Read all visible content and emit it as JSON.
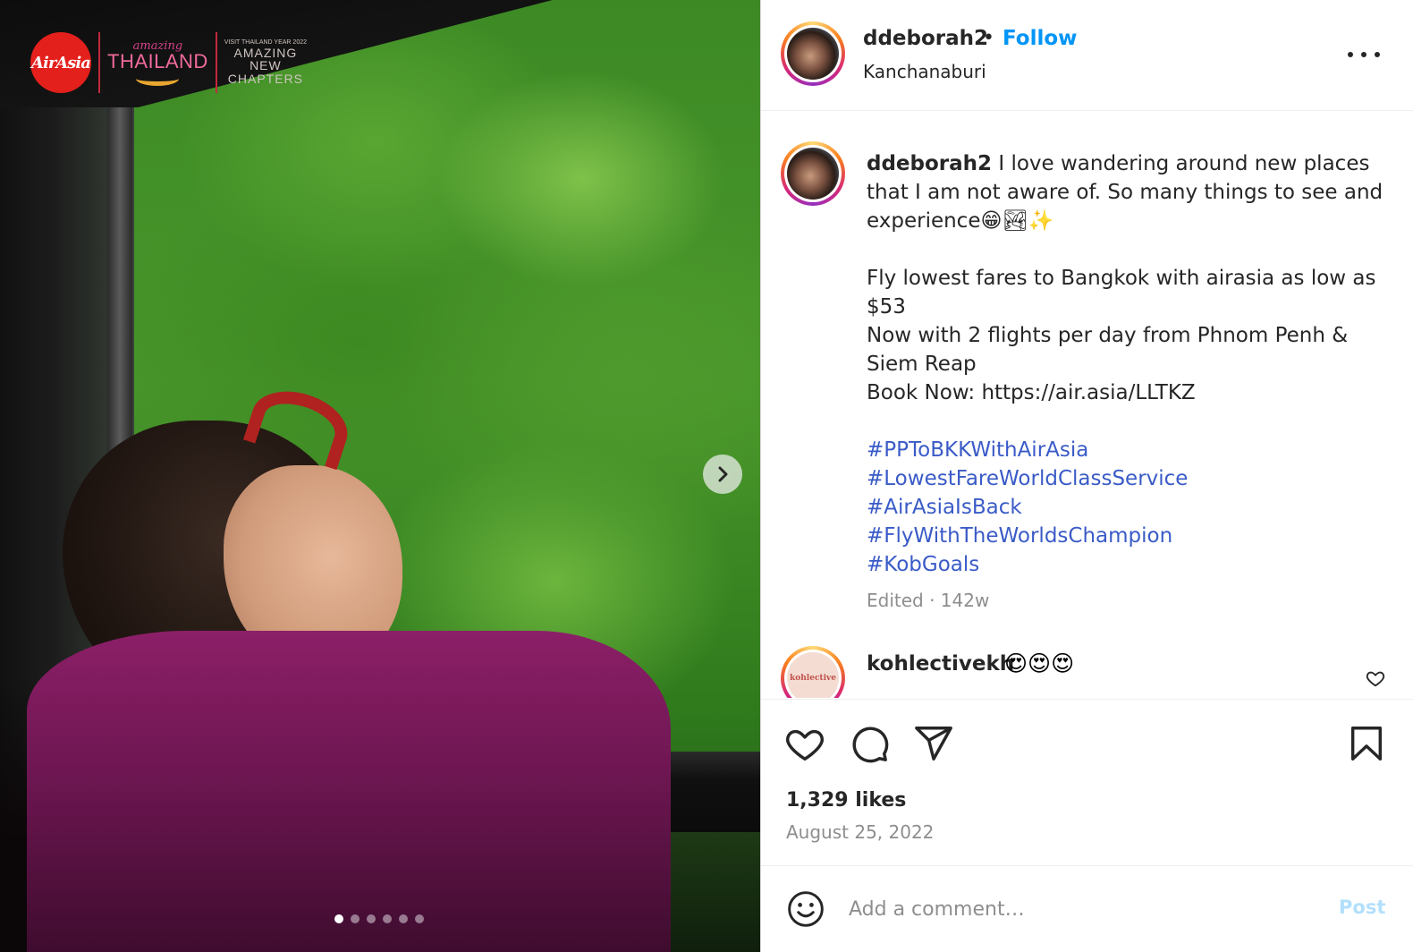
{
  "media": {
    "logos": {
      "airasia": "AirAsia",
      "amazing": "amazing",
      "thailand": "THAILAND",
      "visit_year": "VISIT THAILAND YEAR 2022",
      "chapters_line1": "AMAZING",
      "chapters_line2": "NEW",
      "chapters_line3": "CHAPTERS"
    },
    "carousel": {
      "total": 6,
      "active_index": 0
    },
    "next_icon": "chevron-right-icon"
  },
  "header": {
    "username": "ddeborah2",
    "separator": "•",
    "follow_label": "Follow",
    "location": "Kanchanaburi",
    "more_icon": "more-horizontal-icon"
  },
  "caption": {
    "username": "ddeborah2",
    "text": " I love wandering around new places that I am not aware of. So many things to see and experience😁🏞✨\n\nFly lowest fares to Bangkok with airasia as low as $53\nNow with 2 flights per day from Phnom Penh & Siem Reap\nBook Now: https://air.asia/LLTKZ",
    "hashtags": [
      "#PPToBKKWithAirAsia",
      "#LowestFareWorldClassService",
      "#AirAsiaIsBack",
      "#FlyWithTheWorldsChampion",
      "#KobGoals"
    ],
    "meta": "Edited · 142w"
  },
  "comment": {
    "username": "kohlectivekh",
    "avatar_text": "kohlective",
    "text": "😍😍😍"
  },
  "actions": {
    "likes": "1,329 likes",
    "date": "August 25, 2022"
  },
  "comment_bar": {
    "placeholder": "Add a comment…",
    "post_label": "Post"
  },
  "colors": {
    "follow": "#0095f6",
    "hashtag": "#3a5bc7",
    "secondary_text": "#8e8e8e",
    "post_disabled": "#b2dffc"
  }
}
